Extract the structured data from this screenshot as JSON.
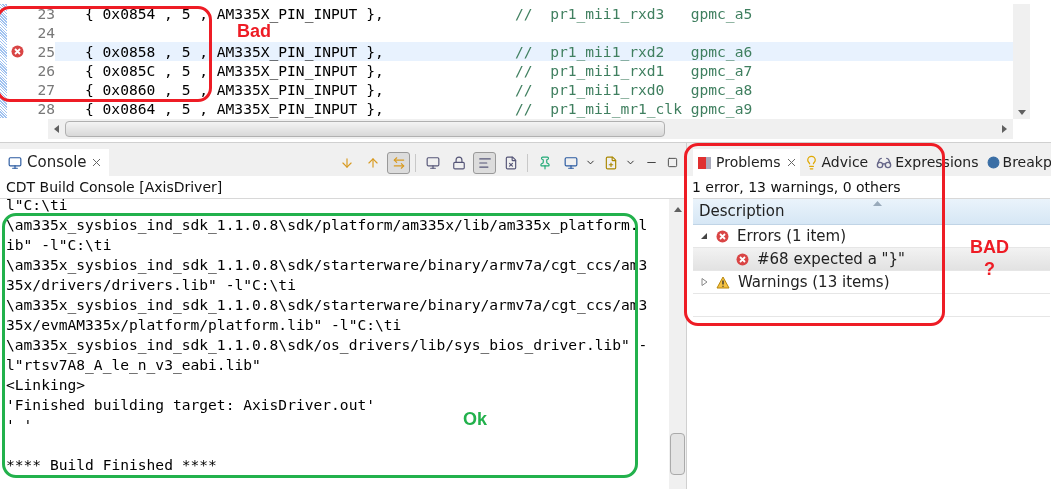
{
  "editor": {
    "lines": [
      {
        "number": "23",
        "code": "{ 0x0854 , 5 , AM335X_PIN_INPUT },",
        "comment": "//  pr1_mii1_rxd3   gpmc_a5",
        "error": false,
        "current": false
      },
      {
        "number": "24",
        "error": false,
        "current": false
      },
      {
        "number": "25",
        "code": "{ 0x0858 , 5 , AM335X_PIN_INPUT },",
        "comment": "//  pr1_mii1_rxd2   gpmc_a6",
        "error": true,
        "current": true
      },
      {
        "number": "26",
        "code": "{ 0x085C , 5 , AM335X_PIN_INPUT },",
        "comment": "//  pr1_mii1_rxd1   gpmc_a7",
        "error": false,
        "current": false
      },
      {
        "number": "27",
        "code": "{ 0x0860 , 5 , AM335X_PIN_INPUT },",
        "comment": "//  pr1_mii1_rxd0   gpmc_a8",
        "error": false,
        "current": false
      },
      {
        "number": "28",
        "code": "{ 0x0864 , 5 , AM335X_PIN_INPUT },",
        "comment": "//  pr1_mii_mr1_clk gpmc_a9",
        "error": false,
        "current": false
      }
    ]
  },
  "console": {
    "tab": {
      "label": "Console",
      "selected": true
    },
    "toolbar": [
      {
        "pressed": false
      },
      {
        "pressed": false
      },
      {
        "pressed": true
      },
      {
        "pressed": false
      },
      {
        "pressed": false
      },
      {
        "pressed": true
      },
      {
        "pressed": false
      },
      {
        "pressed": false
      },
      {
        "pressed": false
      },
      {
        "pressed": false
      }
    ],
    "title": "CDT Build Console [AxisDriver]",
    "lines": [
      {
        "kind": "output",
        "text": "l\"C:\\ti"
      },
      {
        "kind": "output",
        "text": "\\am335x_sysbios_ind_sdk_1.1.0.8\\sdk/platform/am335x/lib/am335x_platform.l"
      },
      {
        "kind": "output",
        "text": "ib\" -l\"C:\\ti"
      },
      {
        "kind": "output",
        "text": "\\am335x_sysbios_ind_sdk_1.1.0.8\\sdk/starterware/binary/armv7a/cgt_ccs/am3"
      },
      {
        "kind": "output",
        "text": "35x/drivers/drivers.lib\" -l\"C:\\ti"
      },
      {
        "kind": "output",
        "text": "\\am335x_sysbios_ind_sdk_1.1.0.8\\sdk/starterware/binary/armv7a/cgt_ccs/am3"
      },
      {
        "kind": "output",
        "text": "35x/evmAM335x/platform/platform.lib\" -l\"C:\\ti"
      },
      {
        "kind": "output",
        "text": "\\am335x_sysbios_ind_sdk_1.1.0.8\\sdk/os_drivers/lib/sys_bios_driver.lib\" -"
      },
      {
        "kind": "output",
        "text": "l\"rtsv7A8_A_le_n_v3_eabi.lib\""
      },
      {
        "kind": "output",
        "text": "<Linking>"
      },
      {
        "kind": "output",
        "text": "'Finished building target: AxisDriver.out'"
      },
      {
        "kind": "output",
        "text": "' '"
      },
      {
        "kind": "blank"
      },
      {
        "kind": "output",
        "text": "**** Build Finished ****"
      }
    ]
  },
  "problems": {
    "tabs": [
      {
        "label": "Problems",
        "selected": true
      },
      {
        "label": "Advice",
        "selected": false
      },
      {
        "label": "Expressions",
        "selected": false
      },
      {
        "label": "Breakp",
        "selected": false
      }
    ],
    "summary": "1 error, 13 warnings, 0 others",
    "columns": [
      "Description"
    ],
    "tree": [
      {
        "kind": "error",
        "label": "Errors (1 item)",
        "expanded": true,
        "children": [
          {
            "kind": "error",
            "label": "#68 expected a \"}\"",
            "selected": true
          }
        ]
      },
      {
        "kind": "warning",
        "label": "Warnings (13 items)",
        "expanded": false
      }
    ]
  },
  "annotations": [
    {
      "color": "#ee1c25",
      "labels": [
        "Bad"
      ]
    },
    {
      "color": "#22b14c",
      "labels": [
        "Ok"
      ]
    },
    {
      "color": "#ee1c25",
      "labels": [
        "BAD",
        "?"
      ]
    }
  ]
}
